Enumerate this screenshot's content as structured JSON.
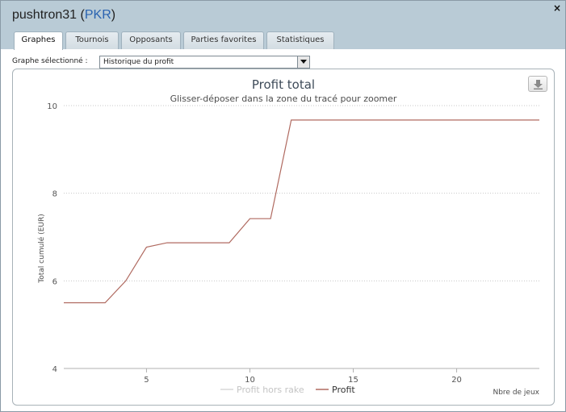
{
  "window": {
    "user": "pushtron31",
    "site": "PKR",
    "close_glyph": "×"
  },
  "tabs": [
    {
      "label": "Graphes",
      "active": true
    },
    {
      "label": "Tournois",
      "active": false
    },
    {
      "label": "Opposants",
      "active": false
    },
    {
      "label": "Parties favorites",
      "active": false
    },
    {
      "label": "Statistiques",
      "active": false
    }
  ],
  "graph_selector": {
    "label": "Graphe sélectionné :",
    "value": "Historique du profit"
  },
  "colors": {
    "profit_line": "#b06a60",
    "profit_hors_rake": "#d8d8d8",
    "header_bg": "#b9cbd6"
  },
  "chart_data": {
    "type": "line",
    "title": "Profit total",
    "subtitle": "Glisser-déposer dans la zone du tracé pour zoomer",
    "xlabel": "Nbre de jeux",
    "ylabel": "Total cumulé (EUR)",
    "xlim": [
      1,
      24
    ],
    "ylim": [
      4,
      10
    ],
    "x_ticks": [
      5,
      10,
      15,
      20
    ],
    "y_ticks": [
      4,
      6,
      8,
      10
    ],
    "grid": true,
    "legend_placement": "bottom-center",
    "series": [
      {
        "name": "Profit hors rake",
        "color": "#d8d8d8",
        "x": [],
        "y": []
      },
      {
        "name": "Profit",
        "color": "#b06a60",
        "x": [
          1,
          2,
          3,
          4,
          5,
          6,
          7,
          8,
          9,
          10,
          11,
          12,
          13,
          14,
          15,
          16,
          17,
          18,
          19,
          20,
          21,
          22,
          23,
          24
        ],
        "y": [
          5.5,
          5.5,
          5.5,
          6.0,
          6.77,
          6.87,
          6.87,
          6.87,
          6.87,
          7.42,
          7.42,
          9.67,
          9.67,
          9.67,
          9.67,
          9.67,
          9.67,
          9.67,
          9.67,
          9.67,
          9.67,
          9.67,
          9.67,
          9.67
        ]
      }
    ]
  }
}
